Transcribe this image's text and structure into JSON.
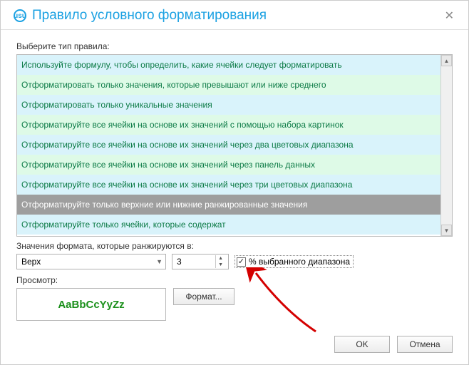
{
  "title": "Правило условного форматирования",
  "select_rule_label": "Выберите тип правила:",
  "rules": [
    "Используйте формулу, чтобы определить, какие ячейки следует форматировать",
    "Отформатировать только значения, которые превышают или ниже среднего",
    "Отформатировать только уникальные значения",
    "Отформатируйте все ячейки на основе их значений с помощью набора картинок",
    "Отформатируйте все ячейки на основе их значений через два цветовых диапазона",
    "Отформатируйте все ячейки на основе их значений через панель данных",
    "Отформатируйте все ячейки на основе их значений через три цветовых диапазона",
    "Отформатируйте только верхние или нижние ранжированные значения",
    "Отформатируйте только ячейки, которые содержат"
  ],
  "selected_rule_index": 7,
  "format_values_label": "Значения формата, которые ранжируются в:",
  "direction_value": "Верх",
  "count_value": "3",
  "percent_checkbox_label": "% выбранного диапазона",
  "percent_checked": true,
  "preview_label": "Просмотр:",
  "preview_text": "AaBbCcYyZz",
  "format_button": "Формат...",
  "ok_button": "OK",
  "cancel_button": "Отмена",
  "icons": {
    "app": "usu",
    "close": "✕",
    "caret_down": "▼",
    "up": "▲",
    "down": "▼",
    "check": "✓"
  }
}
